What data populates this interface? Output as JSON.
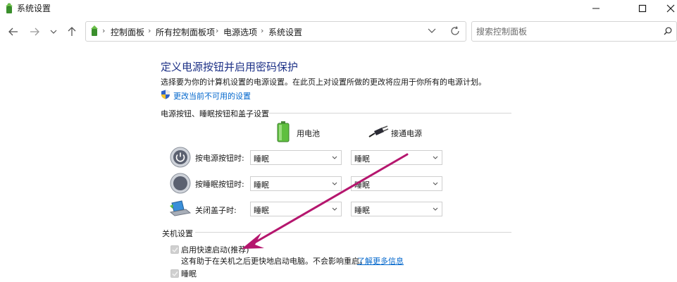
{
  "window": {
    "title": "系统设置"
  },
  "address": {
    "breadcrumbs": [
      "控制面板",
      "所有控制面板项",
      "电源选项",
      "系统设置"
    ]
  },
  "search": {
    "placeholder": "搜索控制面板"
  },
  "main": {
    "title": "定义电源按钮并启用密码保护",
    "description": "选择要为你的计算机设置的电源设置。在此页上对设置所做的更改将应用于你所有的电源计划。",
    "change_link": "更改当前不可用的设置",
    "power_section": {
      "heading": "电源按钮、睡眠按钮和盖子设置",
      "columns": [
        "用电池",
        "接通电源"
      ],
      "rows": [
        {
          "label": "按电源按钮时:",
          "battery": "睡眠",
          "plugged": "睡眠"
        },
        {
          "label": "按睡眠按钮时:",
          "battery": "睡眠",
          "plugged": "睡眠"
        },
        {
          "label": "关闭盖子时:",
          "battery": "睡眠",
          "plugged": "睡眠"
        }
      ]
    },
    "shutdown_section": {
      "heading": "关机设置",
      "fast_startup": {
        "label": "启用快速启动(推荐)",
        "checked": true,
        "help": "这有助于在关机之后更快地启动电脑。不会影响重启。",
        "learn_more": "了解更多信息"
      },
      "sleep": {
        "label": "睡眠",
        "checked": true
      }
    }
  },
  "colors": {
    "title_blue": "#1e3287",
    "link_blue": "#0066cc",
    "annotation_arrow": "#b5166e"
  }
}
